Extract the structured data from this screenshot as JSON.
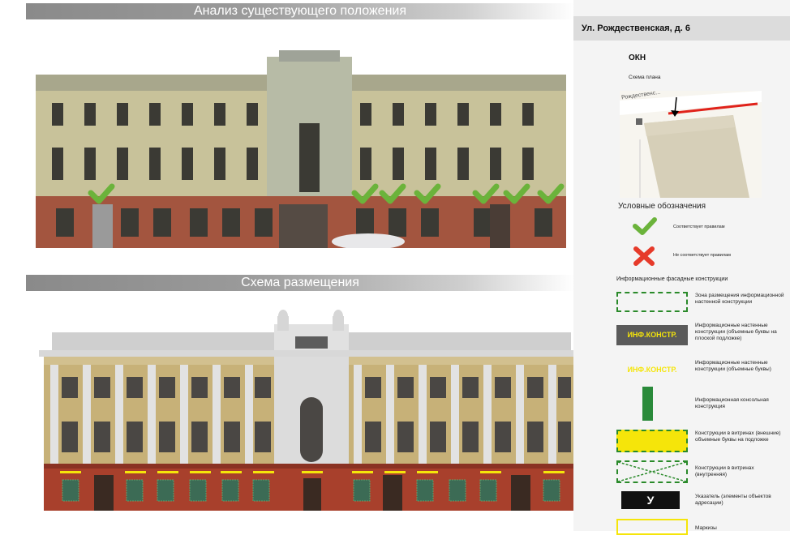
{
  "top_banner": "Анализ существующего положения",
  "middle_banner": "Схема размещения",
  "panel": {
    "address": "Ул. Рождественская, д. 6",
    "okn": "ОКН",
    "plan_label": "Схема плана",
    "map_street": "Рождественс..."
  },
  "legend": {
    "title": "Условные обозначения",
    "ok": "Соответствует правилам",
    "bad": "Не соответствует правилам",
    "facade_title": "Информационные фасадные конструкции",
    "items": [
      "Зона размещения информационной настенной конструкции",
      "Информационные настенные конструкции (объемные буквы на плоской подложке)",
      "Информационные настенные конструкции (объемные буквы)",
      "Информационная консольная конструкция",
      "Конструкции в витринах (внешние) объемные буквы на подложке",
      "Конструкции в витринах (внутренняя)",
      "Указатель (элементы объектов адресации)",
      "Маркизы"
    ],
    "inf_label": "ИНФ.КОНСТР.",
    "pointer_label": "У"
  },
  "colors": {
    "check": "#6bb33b",
    "cross": "#e63a2a",
    "zone": "#2a8a2a",
    "yellow": "#f5e50a",
    "brick": "#a8402c",
    "facade": "#c9b27a"
  }
}
